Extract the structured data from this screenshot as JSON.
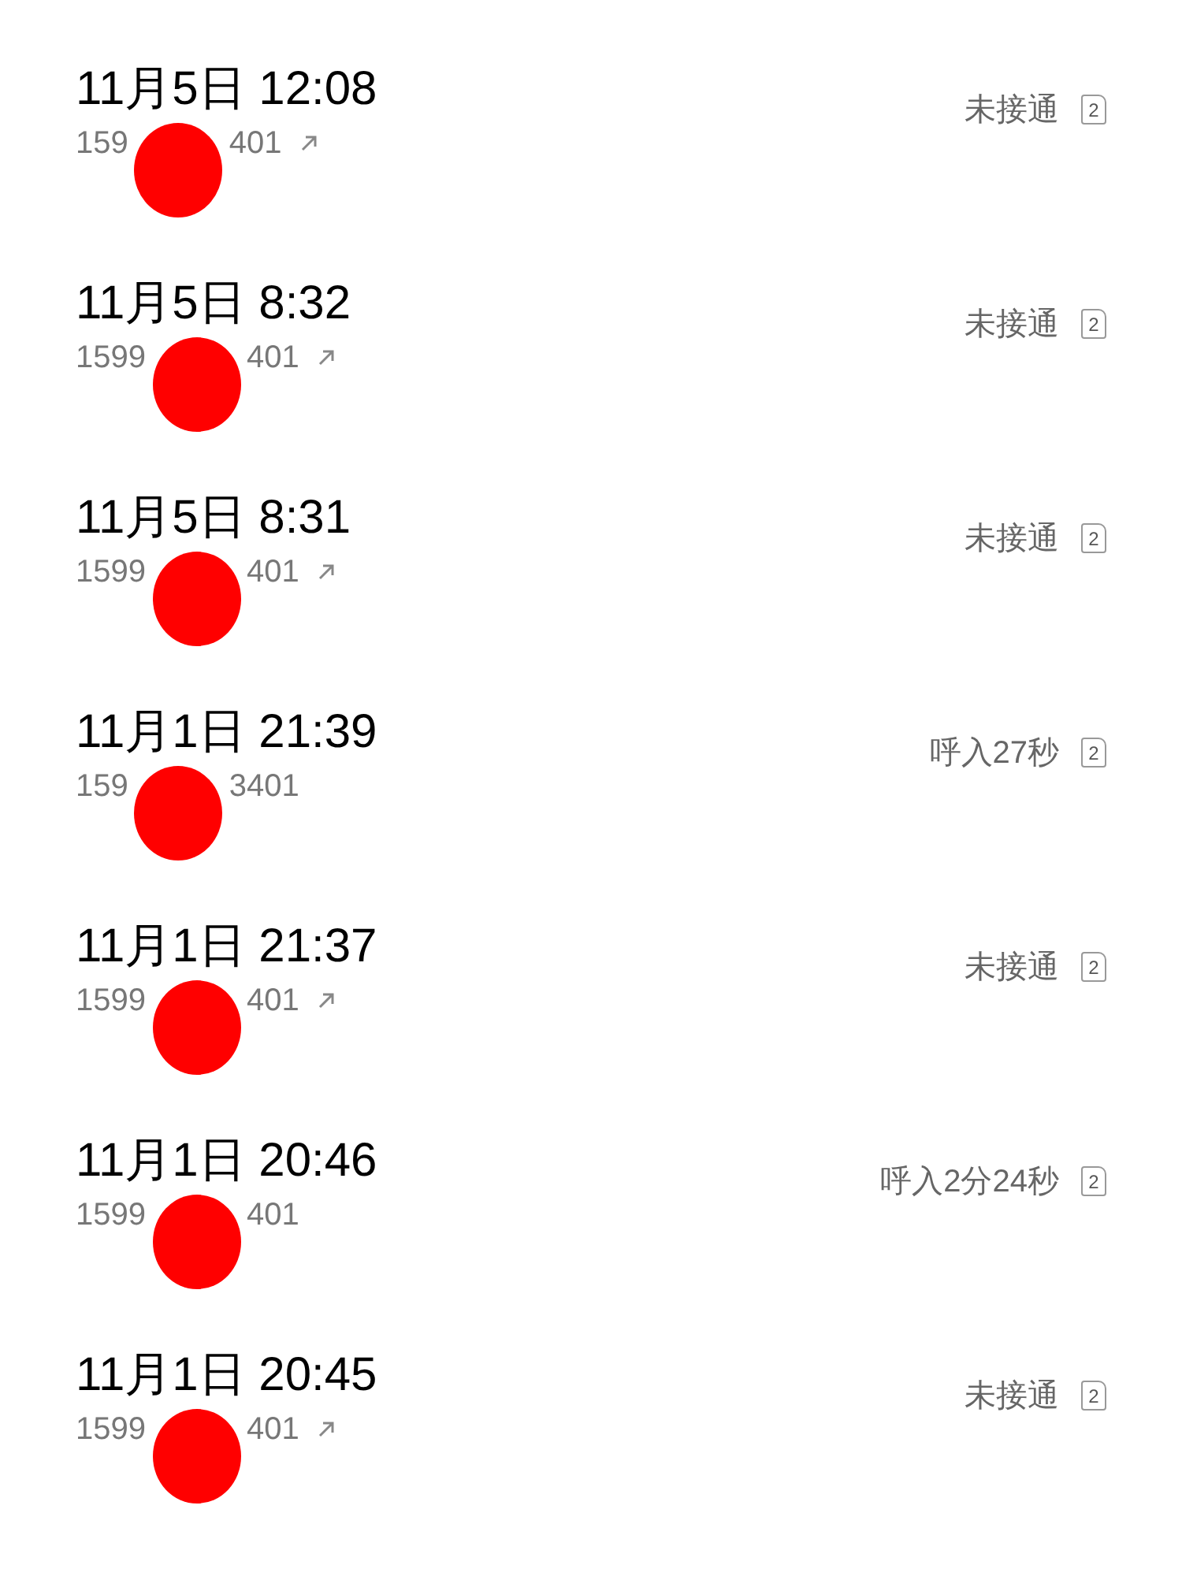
{
  "calls": [
    {
      "time": "11月5日 12:08",
      "number_start": "159",
      "number_end": "401",
      "outgoing": true,
      "status": "未接通",
      "sim": "2"
    },
    {
      "time": "11月5日 8:32",
      "number_start": "1599",
      "number_end": "401",
      "outgoing": true,
      "status": "未接通",
      "sim": "2"
    },
    {
      "time": "11月5日 8:31",
      "number_start": "1599",
      "number_end": "401",
      "outgoing": true,
      "status": "未接通",
      "sim": "2"
    },
    {
      "time": "11月1日 21:39",
      "number_start": "159",
      "number_end": "3401",
      "outgoing": false,
      "status": "呼入27秒",
      "sim": "2"
    },
    {
      "time": "11月1日 21:37",
      "number_start": "1599",
      "number_end": "401",
      "outgoing": true,
      "status": "未接通",
      "sim": "2"
    },
    {
      "time": "11月1日 20:46",
      "number_start": "1599",
      "number_end": "401",
      "outgoing": false,
      "status": "呼入2分24秒",
      "sim": "2"
    },
    {
      "time": "11月1日 20:45",
      "number_start": "1599",
      "number_end": "401",
      "outgoing": true,
      "status": "未接通",
      "sim": "2"
    }
  ]
}
